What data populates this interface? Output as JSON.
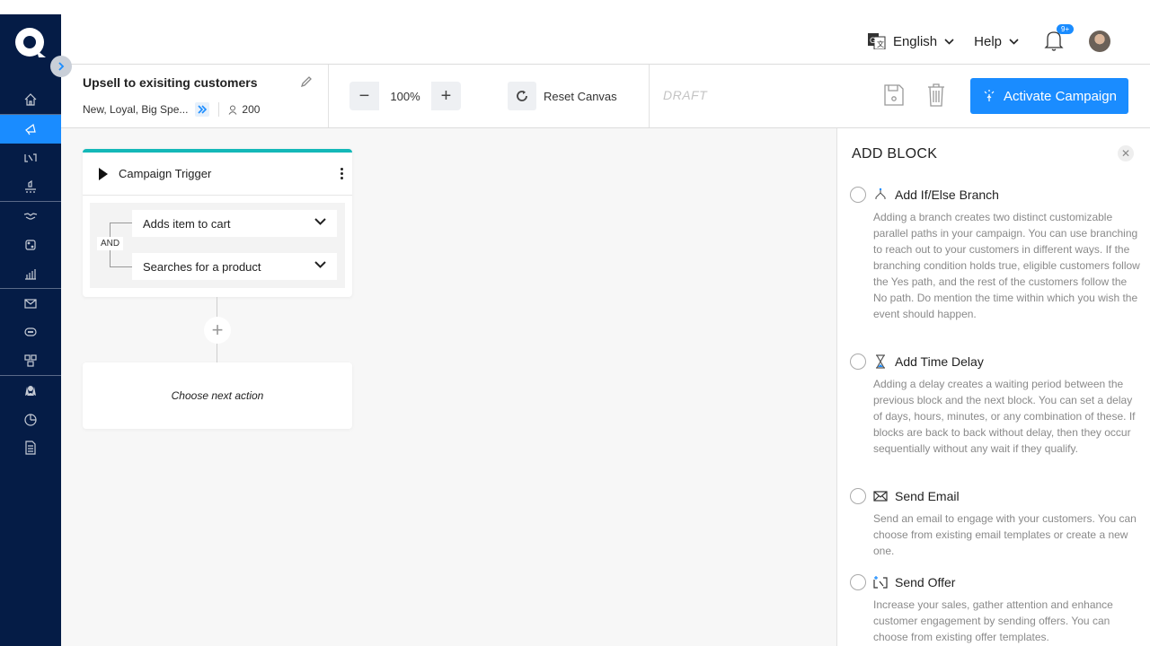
{
  "topbar": {
    "language": "English",
    "help": "Help",
    "notification_badge": "9+"
  },
  "campaign": {
    "title": "Upsell to exisiting customers",
    "segments": "New, Loyal, Big Spe...",
    "user_count": "200",
    "status": "DRAFT"
  },
  "toolbar": {
    "zoom_value": "100%",
    "zoom_out": "−",
    "zoom_in": "+",
    "reset_label": "Reset Canvas",
    "activate_label": "Activate Campaign"
  },
  "canvas": {
    "trigger_title": "Campaign Trigger",
    "operator": "AND",
    "conditions": [
      "Adds item to cart",
      "Searches for a product"
    ],
    "add_symbol": "+",
    "next_action": "Choose next action"
  },
  "panel": {
    "title": "ADD BLOCK",
    "close": "✕",
    "blocks": [
      {
        "icon": "branch-icon",
        "label": "Add If/Else Branch",
        "description": "Adding a branch creates two distinct customizable parallel paths in your campaign. You can use branching to reach out to your customers in different ways. If the branching condition holds true, eligible customers follow the Yes path, and the rest of the customers follow the No path. Do mention the time within which you wish the event should happen."
      },
      {
        "icon": "hourglass-icon",
        "label": "Add Time Delay",
        "description": "Adding a delay creates a waiting period between the previous block and the next block. You can set a delay of days, hours, minutes, or any combination of these. If blocks are back to back without delay, then they occur sequentially without any wait if they qualify."
      },
      {
        "icon": "email-icon",
        "label": "Send Email",
        "description": "Send an email to engage with your customers. You can choose from existing email templates or create a new one."
      },
      {
        "icon": "offer-icon",
        "label": "Send Offer",
        "description": "Increase your sales, gather attention and enhance customer engagement by sending offers. You can choose from existing offer templates."
      }
    ]
  },
  "colors": {
    "sidebar": "#051c46",
    "accent": "#1a8cff",
    "trigger_bar": "#14b8b8"
  }
}
